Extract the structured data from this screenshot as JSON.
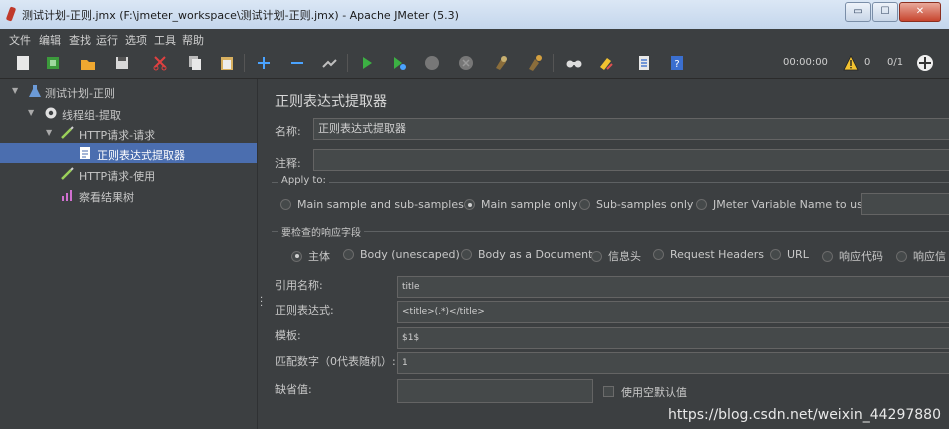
{
  "window": {
    "title": "测试计划-正则.jmx (F:\\jmeter_workspace\\测试计划-正则.jmx) - Apache JMeter (5.3)",
    "min_symbol": "▭",
    "max_symbol": "☐",
    "close_symbol": "✕"
  },
  "menu": [
    "文件",
    "编辑",
    "查找",
    "运行",
    "选项",
    "工具",
    "帮助"
  ],
  "toolbar": {
    "icons": [
      "new-icon",
      "templates-icon",
      "open-icon",
      "save-icon",
      "cut-icon",
      "copy-icon",
      "paste-icon",
      "expand-icon",
      "collapse-icon",
      "toggle-icon",
      "start-icon",
      "start-no-pause-icon",
      "stop-icon",
      "shutdown-icon",
      "clear-icon",
      "clear-all-icon",
      "search-icon",
      "reset-search-icon",
      "function-helper-icon",
      "help-icon"
    ],
    "timer": "00:00:00",
    "warnings": "0",
    "threads": "0/1"
  },
  "tree": {
    "items": [
      {
        "label": "测试计划-正则",
        "icon": "flask-icon"
      },
      {
        "label": "线程组-提取",
        "icon": "gear-icon"
      },
      {
        "label": "HTTP请求-请求",
        "icon": "pipette-icon"
      },
      {
        "label": "正则表达式提取器",
        "icon": "document-icon"
      },
      {
        "label": "HTTP请求-使用",
        "icon": "pipette-icon"
      },
      {
        "label": "察看结果树",
        "icon": "chart-icon"
      }
    ]
  },
  "panel": {
    "title": "正则表达式提取器",
    "name_label": "名称:",
    "name_value": "正则表达式提取器",
    "comment_label": "注释:",
    "comment_value": "",
    "apply_to": {
      "title": "Apply to:",
      "options": [
        "Main sample and sub-samples",
        "Main sample only",
        "Sub-samples only",
        "JMeter Variable Name to use"
      ],
      "selected": 1
    },
    "field_check": {
      "title": "要检查的响应字段",
      "options": [
        "主体",
        "Body (unescaped)",
        "Body as a Document",
        "信息头",
        "Request Headers",
        "URL",
        "响应代码",
        "响应信"
      ],
      "selected": 0
    },
    "ref_label": "引用名称:",
    "ref_value": "title",
    "regex_label": "正则表达式:",
    "regex_value": "<title>(.*)</title>",
    "template_label": "模板:",
    "template_value": "$1$",
    "match_label": "匹配数字（0代表随机）:",
    "match_value": "1",
    "default_label": "缺省值:",
    "default_value": "",
    "empty_default_label": "使用空默认值"
  },
  "watermark": "https://blog.csdn.net/weixin_44297880"
}
